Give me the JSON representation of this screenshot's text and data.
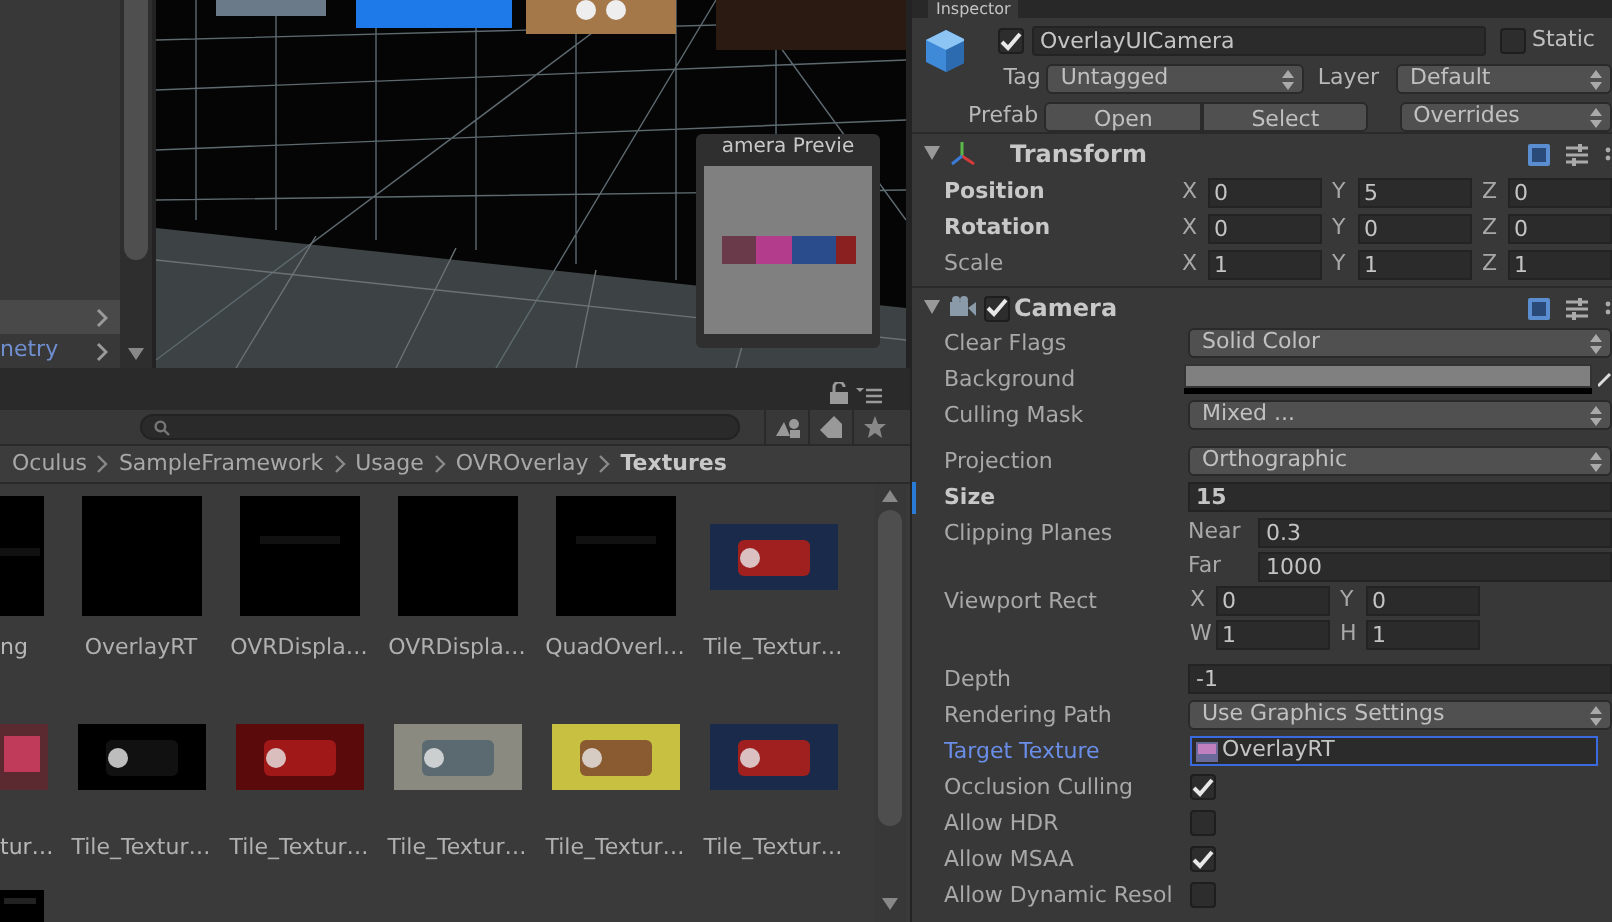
{
  "hierarchy": {
    "rows": [
      {
        "selected": true
      },
      {
        "label": "netry",
        "selected": false
      }
    ]
  },
  "camera_preview": {
    "title": "amera Previe"
  },
  "project": {
    "breadcrumb": [
      {
        "label": "Oculus",
        "current": false
      },
      {
        "label": "SampleFramework",
        "current": false
      },
      {
        "label": "Usage",
        "current": false
      },
      {
        "label": "OVROverlay",
        "current": false
      },
      {
        "label": "Textures",
        "current": true
      }
    ],
    "rows": [
      {
        "cut_label": "ng",
        "items": [
          {
            "label": "OverlayRT",
            "kind": "square"
          },
          {
            "label": "OVRDispla…",
            "kind": "square"
          },
          {
            "label": "OVRDispla…",
            "kind": "square"
          },
          {
            "label": "QuadOverl…",
            "kind": "square"
          },
          {
            "label": "Tile_Textur…",
            "kind": "wide"
          }
        ]
      },
      {
        "cut_label": "tur…",
        "items": [
          {
            "label": "Tile_Textur…",
            "kind": "wide"
          },
          {
            "label": "Tile_Textur…",
            "kind": "wide"
          },
          {
            "label": "Tile_Textur…",
            "kind": "wide"
          },
          {
            "label": "Tile_Textur…",
            "kind": "wide"
          },
          {
            "label": "Tile_Textur…",
            "kind": "wide"
          }
        ]
      }
    ]
  },
  "inspector": {
    "tab": "Inspector",
    "object": {
      "active": true,
      "name": "OverlayUICamera",
      "static": false,
      "static_label": "Static",
      "tag_label": "Tag",
      "tag": "Untagged",
      "layer_label": "Layer",
      "layer": "Default",
      "prefab_label": "Prefab",
      "prefab_buttons": [
        "Open",
        "Select"
      ],
      "overrides": "Overrides"
    },
    "transform": {
      "title": "Transform",
      "expanded": true,
      "rows": [
        {
          "label": "Position",
          "overridden": true,
          "axes": [
            [
              "X",
              "0"
            ],
            [
              "Y",
              "5"
            ],
            [
              "Z",
              "0"
            ]
          ]
        },
        {
          "label": "Rotation",
          "overridden": true,
          "axes": [
            [
              "X",
              "0"
            ],
            [
              "Y",
              "0"
            ],
            [
              "Z",
              "0"
            ]
          ]
        },
        {
          "label": "Scale",
          "overridden": false,
          "axes": [
            [
              "X",
              "1"
            ],
            [
              "Y",
              "1"
            ],
            [
              "Z",
              "1"
            ]
          ]
        }
      ]
    },
    "camera": {
      "title": "Camera",
      "expanded": true,
      "enabled": true,
      "sections": [
        [
          {
            "kind": "dropdown",
            "label": "Clear Flags",
            "value": "Solid Color"
          },
          {
            "kind": "color",
            "label": "Background",
            "color": "#808080"
          },
          {
            "kind": "dropdown",
            "label": "Culling Mask",
            "value": "Mixed ..."
          }
        ],
        [
          {
            "kind": "dropdown",
            "label": "Projection",
            "value": "Orthographic"
          },
          {
            "kind": "field",
            "label": "Size",
            "value": "15",
            "overridden": true,
            "changed": true
          },
          {
            "kind": "pairs",
            "label": "Clipping Planes",
            "pairs": [
              [
                "Near",
                "0.3"
              ],
              [
                "Far",
                "1000"
              ]
            ]
          },
          {
            "kind": "rect",
            "label": "Viewport Rect",
            "rows": [
              [
                [
                  "X",
                  "0"
                ],
                [
                  "Y",
                  "0"
                ]
              ],
              [
                [
                  "W",
                  "1"
                ],
                [
                  "H",
                  "1"
                ]
              ]
            ]
          }
        ],
        [
          {
            "kind": "field",
            "label": "Depth",
            "value": "-1"
          },
          {
            "kind": "dropdown",
            "label": "Rendering Path",
            "value": "Use Graphics Settings"
          },
          {
            "kind": "object",
            "label": "Target Texture",
            "value": "OverlayRT",
            "highlighted": true
          },
          {
            "kind": "checkbox",
            "label": "Occlusion Culling",
            "checked": true
          },
          {
            "kind": "checkbox",
            "label": "Allow HDR",
            "checked": false
          },
          {
            "kind": "checkbox",
            "label": "Allow MSAA",
            "checked": true
          },
          {
            "kind": "checkbox",
            "label": "Allow Dynamic Resol",
            "checked": false
          }
        ]
      ]
    }
  }
}
